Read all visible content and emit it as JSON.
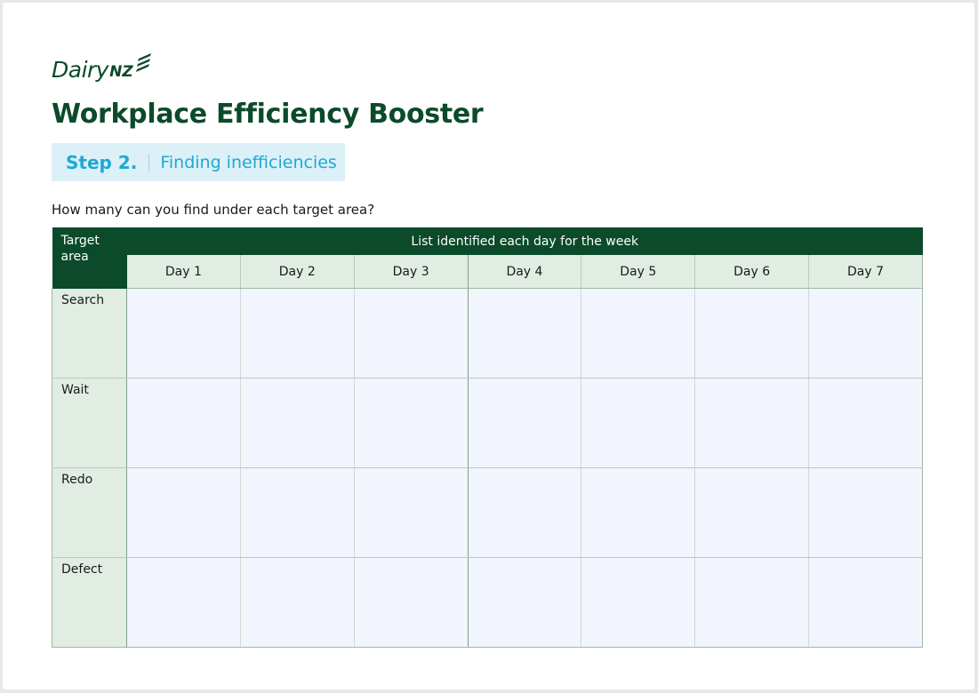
{
  "brand": {
    "logo_text": "Dairy",
    "logo_suffix": "NZ",
    "color": "#0b4a2a"
  },
  "header": {
    "title": "Workplace Efficiency Booster"
  },
  "step": {
    "number": "Step 2.",
    "title": "Finding inefficiencies",
    "accent_color": "#1fa8d4",
    "background_color": "#dcf0f7"
  },
  "prompt": "How many can you find under each target area?",
  "table": {
    "corner_header": "Target area",
    "group_header": "List identified each day for the week",
    "days": [
      "Day 1",
      "Day 2",
      "Day 3",
      "Day 4",
      "Day 5",
      "Day 6",
      "Day 7"
    ],
    "rows": [
      {
        "label": "Search",
        "values": [
          "",
          "",
          "",
          "",
          "",
          "",
          ""
        ]
      },
      {
        "label": "Wait",
        "values": [
          "",
          "",
          "",
          "",
          "",
          "",
          ""
        ]
      },
      {
        "label": "Redo",
        "values": [
          "",
          "",
          "",
          "",
          "",
          "",
          ""
        ]
      },
      {
        "label": "Defect",
        "values": [
          "",
          "",
          "",
          "",
          "",
          "",
          ""
        ]
      }
    ],
    "header_color": "#0b4a2a",
    "subheader_color": "#e1ede3",
    "cell_color": "#f2f5fd"
  }
}
